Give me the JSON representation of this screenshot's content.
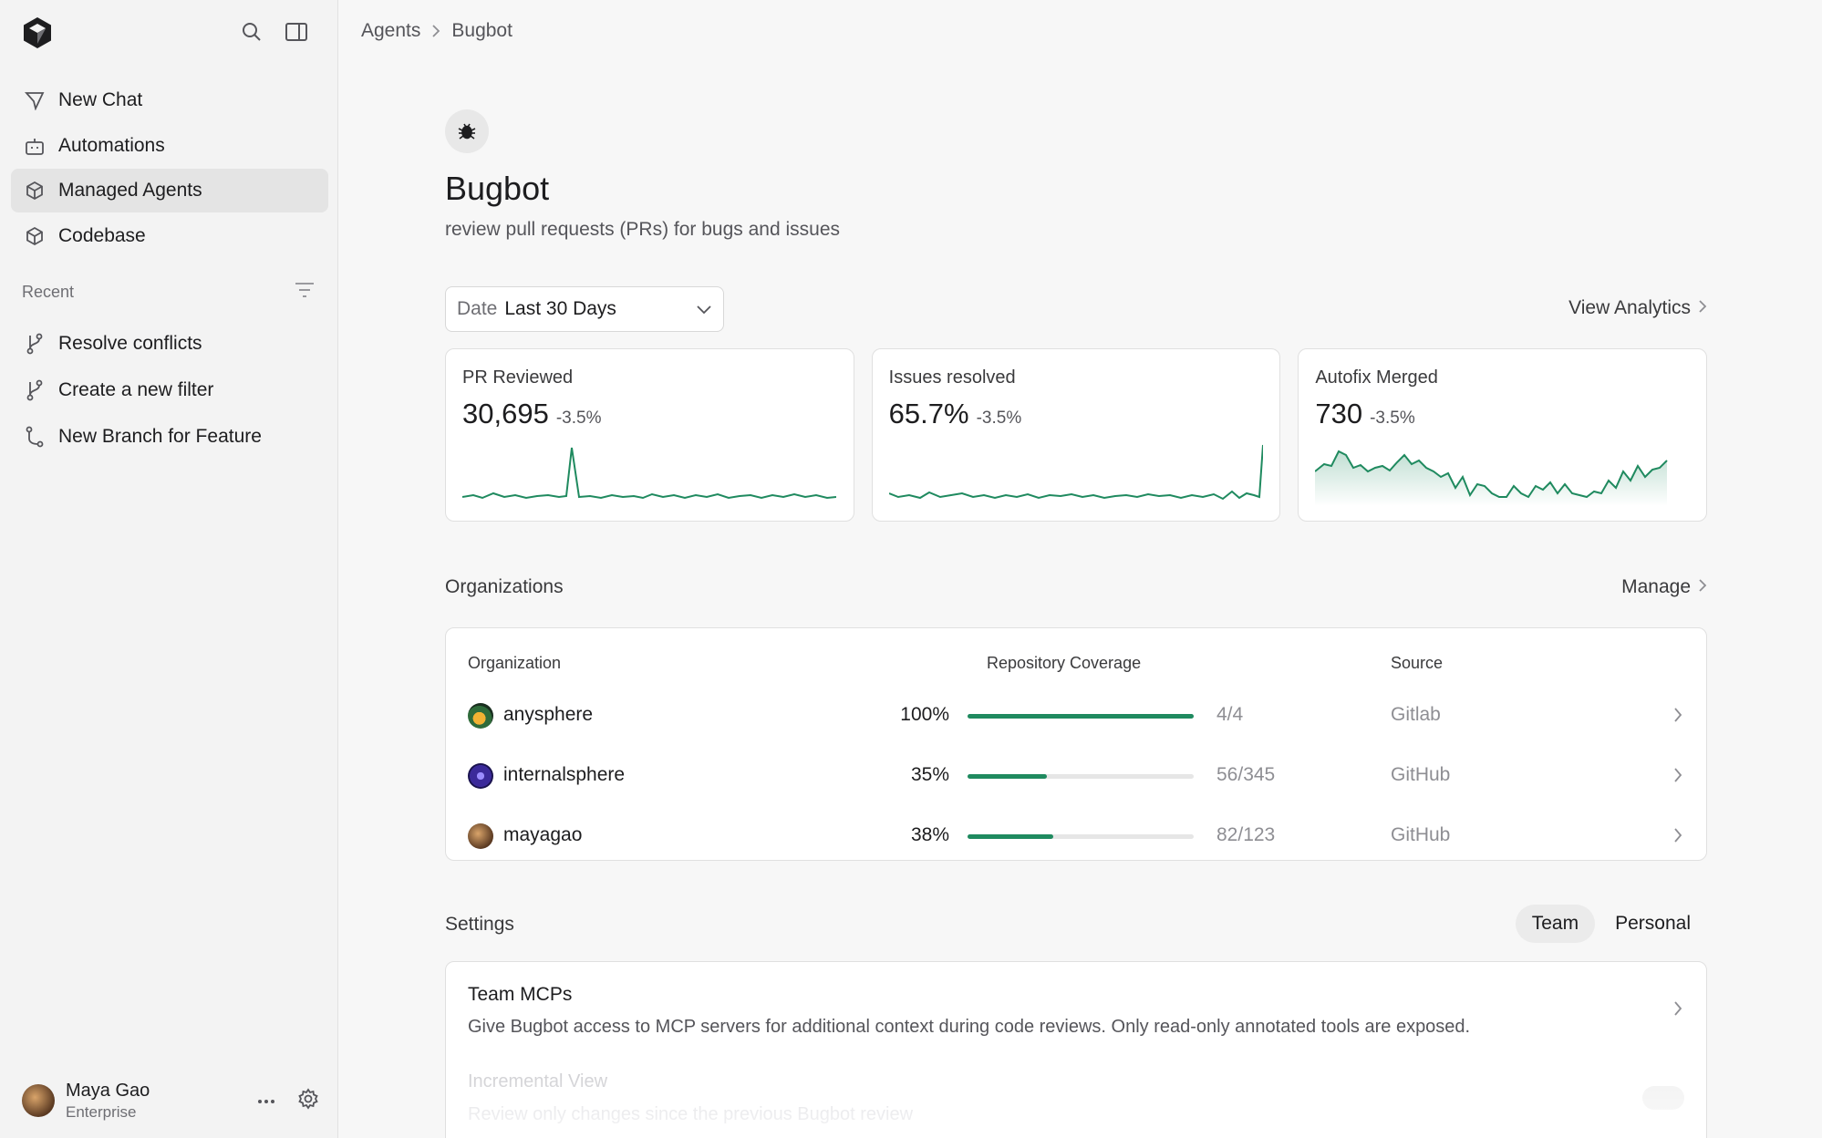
{
  "sidebar": {
    "nav": [
      {
        "label": "New Chat",
        "icon": "send-icon"
      },
      {
        "label": "Automations",
        "icon": "robot-icon"
      },
      {
        "label": "Managed Agents",
        "icon": "cube-icon"
      },
      {
        "label": "Codebase",
        "icon": "box-icon"
      }
    ],
    "recent_label": "Recent",
    "recent": [
      {
        "label": "Resolve conflicts"
      },
      {
        "label": "Create a new filter"
      },
      {
        "label": "New Branch for Feature"
      }
    ],
    "user": {
      "name": "Maya Gao",
      "plan": "Enterprise"
    }
  },
  "breadcrumb": {
    "parent": "Agents",
    "current": "Bugbot"
  },
  "agent": {
    "title": "Bugbot",
    "description": "review pull requests (PRs) for bugs and issues"
  },
  "filters": {
    "date_label": "Date",
    "date_value": "Last 30 Days",
    "view_analytics": "View Analytics"
  },
  "metrics": [
    {
      "label": "PR Reviewed",
      "value": "30,695",
      "delta": "-3.5%"
    },
    {
      "label": "Issues resolved",
      "value": "65.7%",
      "delta": "-3.5%"
    },
    {
      "label": "Autofix Merged",
      "value": "730",
      "delta": "-3.5%"
    }
  ],
  "organizations": {
    "title": "Organizations",
    "manage": "Manage",
    "columns": {
      "org": "Organization",
      "coverage": "Repository Coverage",
      "source": "Source"
    },
    "rows": [
      {
        "name": "anysphere",
        "pct": "100%",
        "fraction": 1.0,
        "count": "4/4",
        "source": "Gitlab"
      },
      {
        "name": "internalsphere",
        "pct": "35%",
        "fraction": 0.35,
        "count": "56/345",
        "source": "GitHub"
      },
      {
        "name": "mayagao",
        "pct": "38%",
        "fraction": 0.38,
        "count": "82/123",
        "source": "GitHub"
      }
    ]
  },
  "settings": {
    "title": "Settings",
    "tabs": [
      {
        "label": "Team",
        "active": true
      },
      {
        "label": "Personal",
        "active": false
      }
    ],
    "items": [
      {
        "title": "Team MCPs",
        "desc": "Give Bugbot access to MCP servers for additional context during code reviews. Only read-only annotated tools are exposed."
      },
      {
        "title": "Incremental View",
        "desc": "Review only changes since the previous Bugbot review"
      }
    ]
  },
  "colors": {
    "accent": "#1f8a5f",
    "track": "#e6e6e6"
  }
}
